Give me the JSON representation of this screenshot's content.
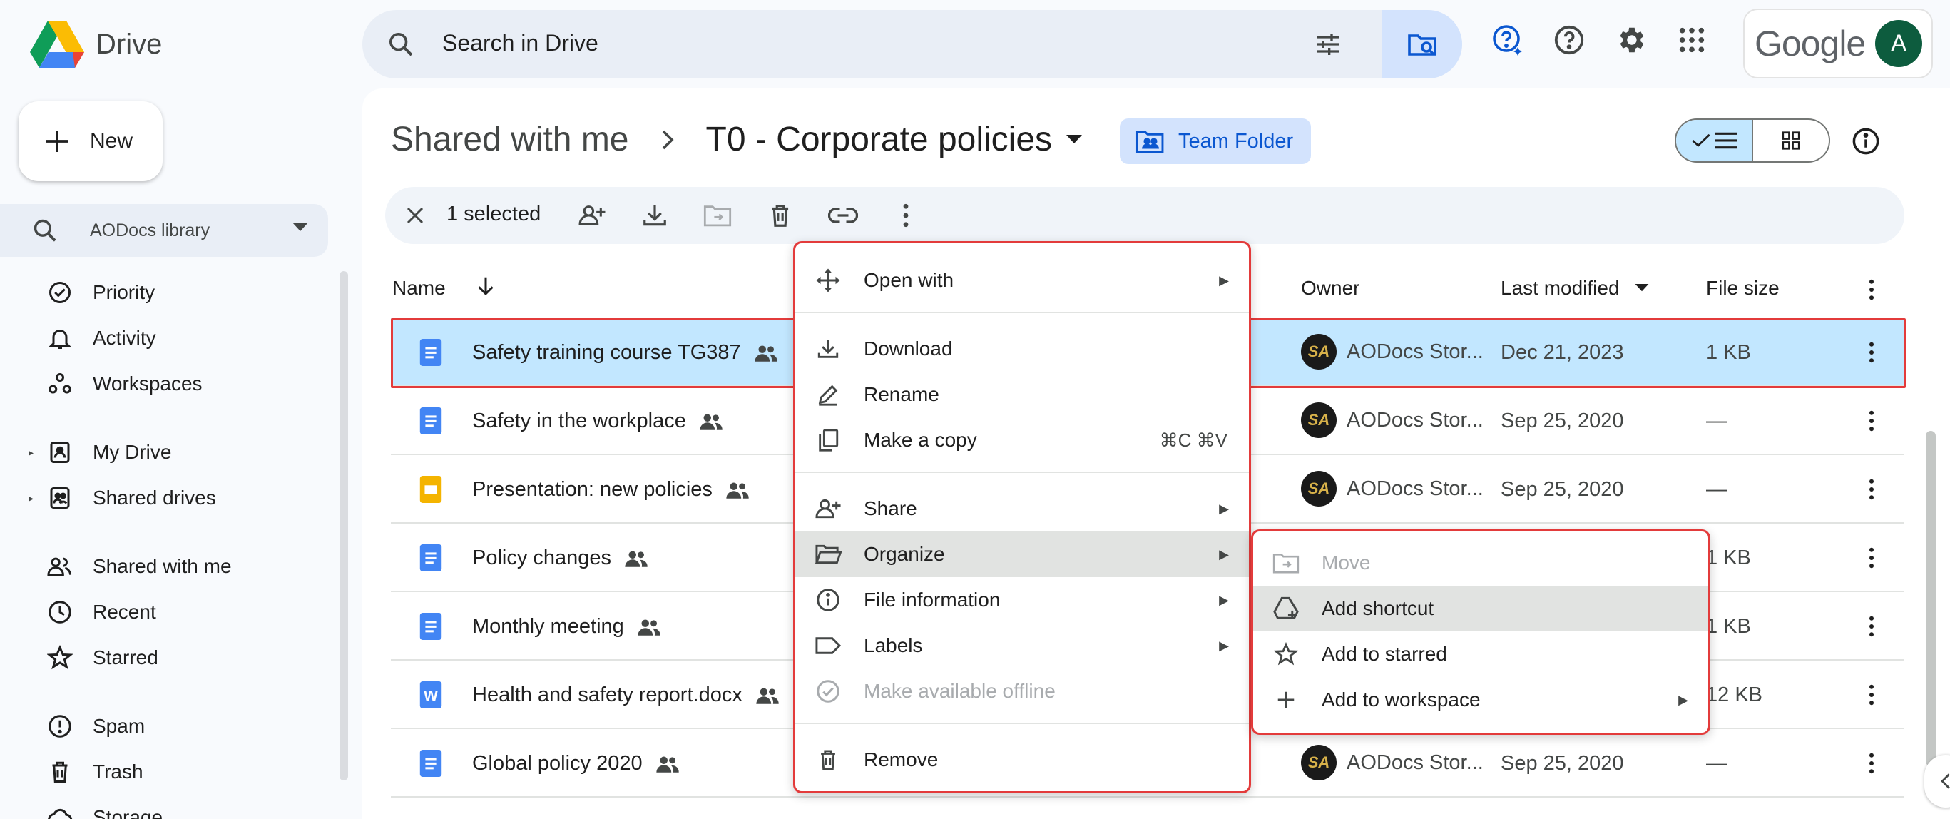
{
  "app": {
    "name": "Drive",
    "brand_word": "Google",
    "avatar_letter": "A"
  },
  "search": {
    "placeholder": "Search in Drive"
  },
  "new_button": {
    "label": "New"
  },
  "sidebar": {
    "library": {
      "label": "AODocs library"
    },
    "items": [
      {
        "label": "Priority",
        "icon": "priority-icon"
      },
      {
        "label": "Activity",
        "icon": "bell-icon"
      },
      {
        "label": "Workspaces",
        "icon": "workspaces-icon"
      },
      {
        "label": "My Drive",
        "icon": "my-drive-icon"
      },
      {
        "label": "Shared drives",
        "icon": "shared-drives-icon"
      },
      {
        "label": "Shared with me",
        "icon": "people-icon"
      },
      {
        "label": "Recent",
        "icon": "clock-icon"
      },
      {
        "label": "Starred",
        "icon": "star-icon"
      },
      {
        "label": "Spam",
        "icon": "spam-icon"
      },
      {
        "label": "Trash",
        "icon": "trash-icon"
      },
      {
        "label": "Storage",
        "icon": "cloud-icon"
      }
    ]
  },
  "breadcrumb": {
    "parent": "Shared with me",
    "current": "T0 - Corporate policies",
    "badge": "Team Folder"
  },
  "actionbar": {
    "selected": "1 selected"
  },
  "table": {
    "headers": {
      "name": "Name",
      "owner": "Owner",
      "modified": "Last modified",
      "size": "File size"
    },
    "rows": [
      {
        "name": "Safety training course TG387",
        "type": "doc",
        "owner": "AODocs Stor...",
        "modified": "Dec 21, 2023",
        "size": "1 KB"
      },
      {
        "name": "Safety in the workplace",
        "type": "doc",
        "owner": "AODocs Stor...",
        "modified": "Sep 25, 2020",
        "size": "—"
      },
      {
        "name": "Presentation: new policies",
        "type": "slides",
        "owner": "AODocs Stor...",
        "modified": "Sep 25, 2020",
        "size": "—"
      },
      {
        "name": "Policy changes",
        "type": "doc",
        "owner": "",
        "modified": "",
        "size": "1 KB"
      },
      {
        "name": "Monthly meeting",
        "type": "doc",
        "owner": "",
        "modified": "",
        "size": "1 KB"
      },
      {
        "name": "Health and safety report.docx",
        "type": "word",
        "owner": "",
        "modified": "",
        "size": "12 KB"
      },
      {
        "name": "Global policy 2020",
        "type": "doc",
        "owner": "AODocs Stor...",
        "modified": "Sep 25, 2020",
        "size": "—"
      }
    ]
  },
  "context_menu": {
    "open_with": "Open with",
    "download": "Download",
    "rename": "Rename",
    "make_copy": "Make a copy",
    "make_copy_shortcut": "⌘C ⌘V",
    "share": "Share",
    "organize": "Organize",
    "file_info": "File information",
    "labels": "Labels",
    "offline": "Make available offline",
    "remove": "Remove"
  },
  "submenu": {
    "move": "Move",
    "add_shortcut": "Add shortcut",
    "add_starred": "Add to starred",
    "add_workspace": "Add to workspace"
  },
  "colors": {
    "accent": "#0b57d0",
    "selected_row": "#c2e7ff",
    "highlight_outline": "#e33b3b"
  }
}
